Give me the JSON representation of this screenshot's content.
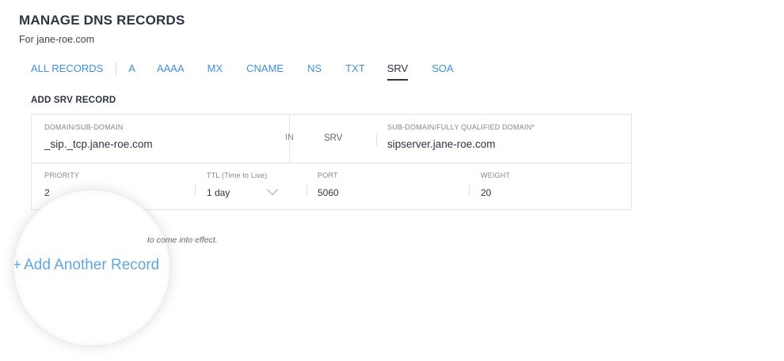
{
  "header": {
    "title": "MANAGE DNS RECORDS",
    "subtitle": "For jane-roe.com"
  },
  "tabs": [
    {
      "label": "ALL RECORDS"
    },
    {
      "label": "A"
    },
    {
      "label": "AAAA"
    },
    {
      "label": "MX"
    },
    {
      "label": "CNAME"
    },
    {
      "label": "NS"
    },
    {
      "label": "TXT"
    },
    {
      "label": "SRV",
      "active": true
    },
    {
      "label": "SOA"
    }
  ],
  "form": {
    "section_title": "ADD SRV RECORD",
    "domain_label": "DOMAIN/SUB-DOMAIN",
    "domain_value": "_sip._tcp.jane-roe.com",
    "in_text": "IN",
    "type_text": "SRV",
    "target_label": "SUB-DOMAIN/FULLY QUALIFIED DOMAIN*",
    "target_value": "sipserver.jane-roe.com",
    "priority_label": "PRIORITY",
    "priority_value": "2",
    "ttl_label": "TTL (Time to Live)",
    "ttl_value": "1 day",
    "port_label": "PORT",
    "port_value": "5060",
    "weight_label": "WEIGHT",
    "weight_value": "20"
  },
  "notice_text": "to come into effect.",
  "add_another": {
    "plus": "+",
    "label": "Add Another Record"
  },
  "colors": {
    "link": "#3f8fd6",
    "text": "#2c3540",
    "border": "#e1e4e8"
  }
}
